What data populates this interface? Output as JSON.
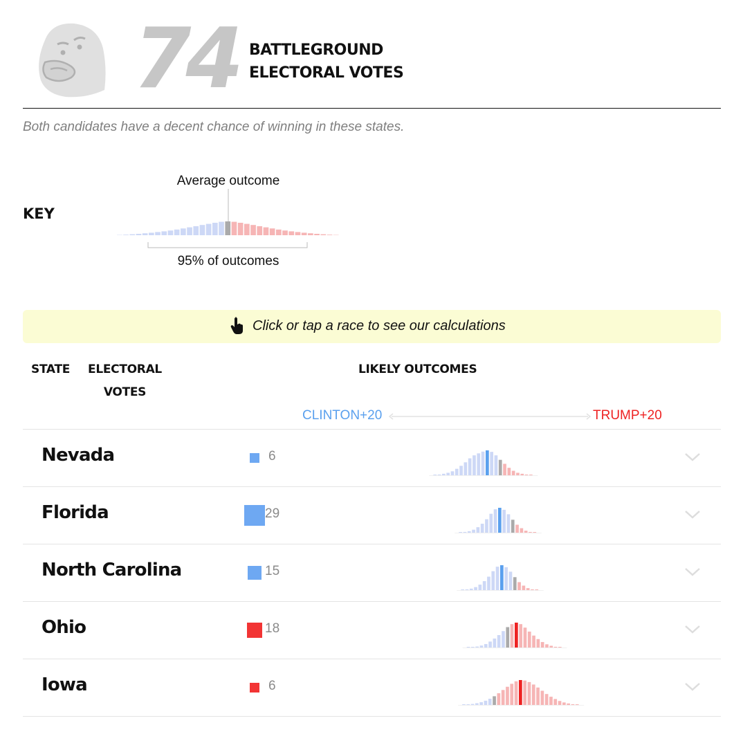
{
  "header": {
    "big_number": "74",
    "title_line1": "BATTLEGROUND",
    "title_line2": "ELECTORAL VOTES",
    "subtitle": "Both candidates have a decent chance of winning in these states."
  },
  "key": {
    "label": "KEY",
    "average_label": "Average outcome",
    "range_label": "95% of outcomes"
  },
  "hint": {
    "icon": "pointer-hand-icon",
    "text": "Click or tap a race to see our calculations"
  },
  "columns": {
    "state": "STATE",
    "ev_line1": "ELECTORAL",
    "ev_line2": "VOTES",
    "outcomes": "LIKELY OUTCOMES",
    "axis_left": "CLINTON+20",
    "axis_right": "TRUMP+20"
  },
  "colors": {
    "clinton": "#5aa0ee",
    "clinton_light": "#cdd8f6",
    "trump": "#ee2222",
    "trump_light": "#f6b5b5",
    "neutral": "#aaaaaa",
    "clinton_square": "#6ea8f2",
    "trump_square": "#f23434"
  },
  "chart_data": {
    "type": "bar",
    "xlabel": "",
    "ylabel": "",
    "x_range": [
      "CLINTON+20",
      "TRUMP+20"
    ],
    "states": [
      {
        "name": "Nevada",
        "electoral_votes": "6",
        "favored": "clinton",
        "mean_bin": 0.26,
        "dist": [
          0.01,
          0.03,
          0.06,
          0.1,
          0.16,
          0.26,
          0.38,
          0.52,
          0.68,
          0.8,
          0.88,
          0.95,
          1.0,
          0.94,
          0.8,
          0.62,
          0.46,
          0.3,
          0.18,
          0.1,
          0.06,
          0.03,
          0.01
        ]
      },
      {
        "name": "Florida",
        "electoral_votes": "29",
        "favored": "clinton",
        "mean_bin": 0.14,
        "dist": [
          0.01,
          0.03,
          0.06,
          0.12,
          0.22,
          0.36,
          0.54,
          0.76,
          0.94,
          1.0,
          0.92,
          0.74,
          0.52,
          0.32,
          0.18,
          0.08,
          0.03,
          0.01
        ]
      },
      {
        "name": "North Carolina",
        "electoral_votes": "15",
        "favored": "clinton",
        "mean_bin": 0.12,
        "dist": [
          0.01,
          0.03,
          0.06,
          0.12,
          0.22,
          0.36,
          0.54,
          0.76,
          0.94,
          1.0,
          0.92,
          0.74,
          0.52,
          0.32,
          0.18,
          0.08,
          0.03,
          0.01
        ]
      },
      {
        "name": "Ohio",
        "electoral_votes": "18",
        "favored": "trump",
        "mean_bin": -0.02,
        "dist": [
          0.01,
          0.02,
          0.04,
          0.08,
          0.14,
          0.24,
          0.36,
          0.5,
          0.66,
          0.82,
          0.94,
          1.0,
          0.94,
          0.8,
          0.64,
          0.48,
          0.34,
          0.22,
          0.13,
          0.07,
          0.03,
          0.01
        ]
      },
      {
        "name": "Iowa",
        "electoral_votes": "6",
        "favored": "trump",
        "mean_bin": -0.06,
        "dist": [
          0.01,
          0.02,
          0.04,
          0.07,
          0.11,
          0.17,
          0.25,
          0.35,
          0.47,
          0.6,
          0.73,
          0.85,
          0.95,
          1.0,
          0.98,
          0.92,
          0.82,
          0.7,
          0.57,
          0.44,
          0.33,
          0.24,
          0.16,
          0.1,
          0.06,
          0.03,
          0.01
        ]
      }
    ],
    "key_dist": [
      0.02,
      0.04,
      0.07,
      0.1,
      0.14,
      0.18,
      0.23,
      0.28,
      0.34,
      0.41,
      0.49,
      0.57,
      0.65,
      0.74,
      0.82,
      0.9,
      0.97,
      1.0,
      0.97,
      0.9,
      0.82,
      0.74,
      0.65,
      0.57,
      0.49,
      0.41,
      0.34,
      0.28,
      0.23,
      0.18,
      0.14,
      0.1,
      0.07,
      0.04,
      0.02
    ]
  }
}
